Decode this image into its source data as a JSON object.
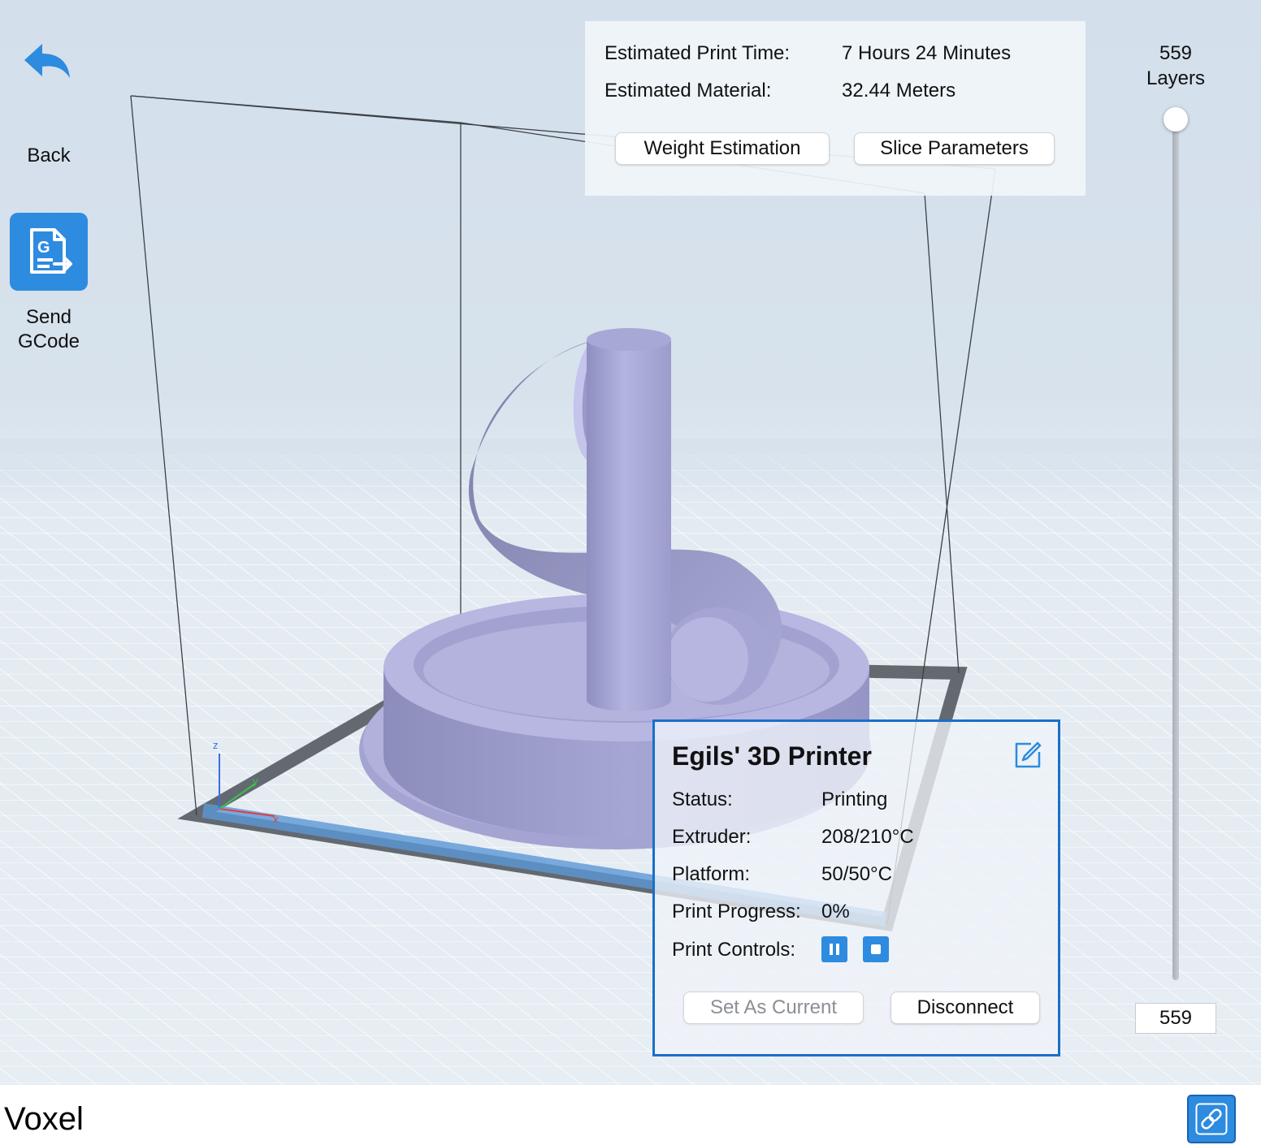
{
  "app": {
    "name": "Voxel"
  },
  "left_toolbar": {
    "back_label": "Back",
    "send_label_line1": "Send",
    "send_label_line2": "GCode",
    "send_icon_letter": "G"
  },
  "viewport": {
    "axis_labels": {
      "x": "x",
      "y": "y",
      "z": "z"
    }
  },
  "estimate": {
    "time_label": "Estimated Print Time:",
    "time_value": "7 Hours 24 Minutes",
    "material_label": "Estimated Material:",
    "material_value": "32.44 Meters",
    "weight_button": "Weight Estimation",
    "slice_button": "Slice Parameters"
  },
  "layers": {
    "count": "559",
    "unit": "Layers",
    "current_value": "559",
    "slider_fraction": 1.0
  },
  "printer": {
    "name": "Egils' 3D Printer",
    "status_label": "Status:",
    "status_value": "Printing",
    "extruder_label": "Extruder:",
    "extruder_value": "208/210°C",
    "platform_label": "Platform:",
    "platform_value": "50/50°C",
    "progress_label": "Print Progress:",
    "progress_value": "0%",
    "controls_label": "Print Controls:",
    "set_current_button": "Set As Current",
    "disconnect_button": "Disconnect"
  },
  "icons": {
    "back": "undo-arrow-icon",
    "send_gcode": "gcode-document-icon",
    "edit": "edit-icon",
    "pause": "pause-icon",
    "stop": "stop-icon",
    "link": "link-icon"
  },
  "colors": {
    "accent": "#2d8be0",
    "panel_border": "#1a6fc8",
    "model": "#adaddb",
    "build_plate_border": "#4c5258",
    "front_edge_highlight": "#5b97d6"
  }
}
